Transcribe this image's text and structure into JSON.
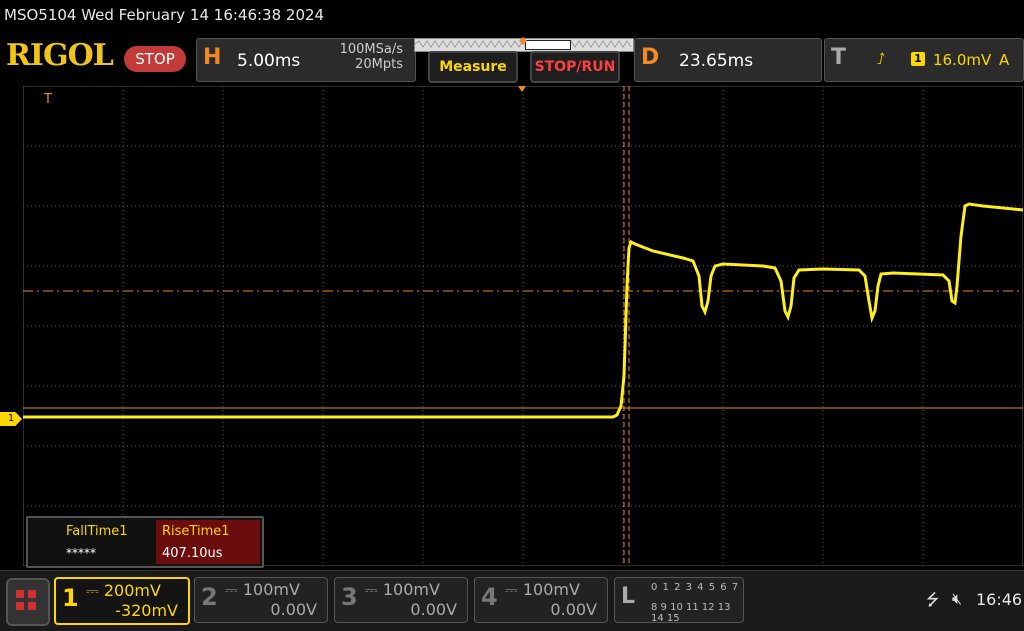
{
  "header": {
    "model_and_date": "MSO5104  Wed February 14 16:46:38 2024",
    "logo": "RIGOL",
    "run_state": "STOP"
  },
  "horizontal": {
    "label": "H",
    "timebase": "5.00ms",
    "sample_rate": "100MSa/s",
    "memory_depth": "20Mpts"
  },
  "buttons": {
    "measure": "Measure",
    "stop_run": "STOP/RUN"
  },
  "delay": {
    "label": "D",
    "value": "23.65ms"
  },
  "trigger": {
    "label": "T",
    "edge_icon": "rising-edge-icon",
    "edge_glyph": "⭜",
    "source": "1",
    "level": "16.0mV",
    "mode": "A"
  },
  "screen": {
    "ch1_marker": "1",
    "trigger_pos_marker": "T",
    "waveform_color": "#ffef1a",
    "grid_color": "#5a5a5a",
    "cursor_color": "#f08a24"
  },
  "measurements": {
    "fall_label": "FallTime1",
    "fall_value": "*****",
    "rise_label": "RiseTime1",
    "rise_value": "407.10us"
  },
  "channels": [
    {
      "num": "1",
      "scale": "200mV",
      "offset": "-320mV",
      "active": true,
      "color": "#ffd700"
    },
    {
      "num": "2",
      "scale": "100mV",
      "offset": "0.00V",
      "active": false
    },
    {
      "num": "3",
      "scale": "100mV",
      "offset": "0.00V",
      "active": false
    },
    {
      "num": "4",
      "scale": "100mV",
      "offset": "0.00V",
      "active": false
    }
  ],
  "logic": {
    "label": "L",
    "row1": "0 1 2 3  4 5 6 7",
    "row2": "8 9 10 11 12 13 14 15"
  },
  "status": {
    "usb_icon": "usb-icon",
    "speaker_icon": "speaker-muted-icon",
    "time": "16:46"
  }
}
